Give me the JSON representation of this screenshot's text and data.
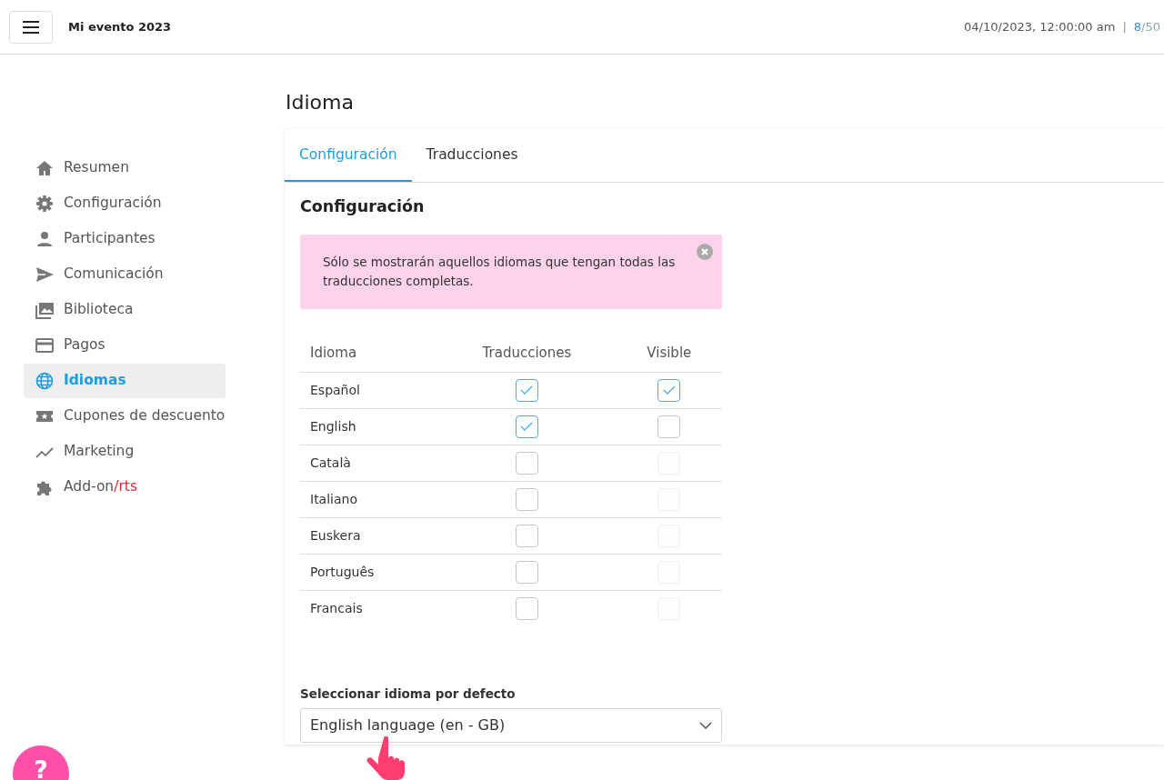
{
  "header": {
    "event_title": "Mi evento 2023",
    "datetime": "04/10/2023, 12:00:00 am",
    "separator": "|",
    "count_current": "8",
    "count_total": "/50"
  },
  "sidebar": {
    "items": [
      {
        "label": "Resumen",
        "selected": false
      },
      {
        "label": "Configuración",
        "selected": false
      },
      {
        "label": "Participantes",
        "selected": false
      },
      {
        "label": "Comunicación",
        "selected": false
      },
      {
        "label": "Biblioteca",
        "selected": false
      },
      {
        "label": "Pagos",
        "selected": false
      },
      {
        "label": "Idiomas",
        "selected": true
      },
      {
        "label": "Cupones de descuento",
        "selected": false
      },
      {
        "label": "Marketing",
        "selected": false
      },
      {
        "label": "Add-on",
        "accent": "/rts",
        "selected": false
      }
    ]
  },
  "page_title": "Idioma",
  "tabs": [
    {
      "label": "Configuración",
      "selected": true
    },
    {
      "label": "Traducciones",
      "selected": false
    }
  ],
  "section_title": "Configuración",
  "alert": {
    "text": "Sólo se mostrarán aquellos idiomas que tengan todas las traducciones completas."
  },
  "table": {
    "columns": [
      "Idioma",
      "Traducciones",
      "Visible"
    ],
    "rows": [
      {
        "language": "Español",
        "translations": true,
        "visible": true,
        "visible_disabled": false
      },
      {
        "language": "English",
        "translations": true,
        "visible": false,
        "visible_disabled": false
      },
      {
        "language": "Català",
        "translations": false,
        "visible": false,
        "visible_disabled": true
      },
      {
        "language": "Italiano",
        "translations": false,
        "visible": false,
        "visible_disabled": true
      },
      {
        "language": "Euskera",
        "translations": false,
        "visible": false,
        "visible_disabled": true
      },
      {
        "language": "Português",
        "translations": false,
        "visible": false,
        "visible_disabled": true
      },
      {
        "language": "Francais",
        "translations": false,
        "visible": false,
        "visible_disabled": true
      }
    ]
  },
  "default_language": {
    "label": "Seleccionar idioma por defecto",
    "value": "English language (en - GB)"
  },
  "help_button": {
    "label": "?"
  }
}
